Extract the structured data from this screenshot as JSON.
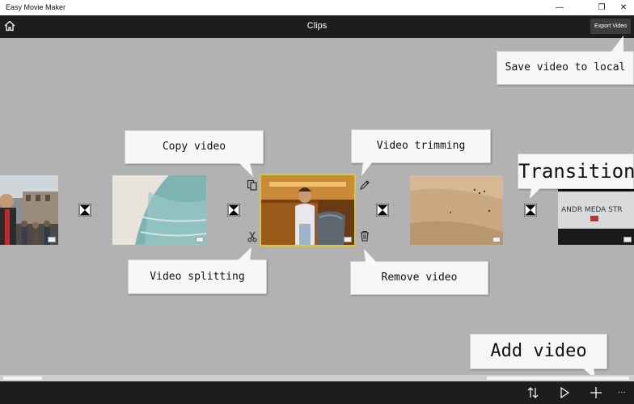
{
  "window": {
    "title": "Easy Movie Maker",
    "minimize_glyph": "—",
    "restore_glyph": "❐",
    "close_glyph": "✕"
  },
  "appbar": {
    "title": "Clips",
    "export_label": "Export Video",
    "home_icon": "home-icon"
  },
  "callouts": {
    "save_local": "Save video to local",
    "copy": "Copy video",
    "trimming": "Video trimming",
    "transition": "Transition",
    "splitting": "Video splitting",
    "remove": "Remove video",
    "add": "Add video"
  },
  "clips": [
    {
      "name": "clip-1-street-scene"
    },
    {
      "name": "clip-2-beach-water"
    },
    {
      "name": "clip-3-man-with-chair",
      "selected": true
    },
    {
      "name": "clip-4-sand-desert"
    },
    {
      "name": "clip-5-andromeda-sign"
    }
  ],
  "clip5_sign_text": "ANDR MEDA STR",
  "colors": {
    "workspace": "#b2b2b2",
    "bars": "#1d1d1d",
    "selection": "#d6c63a"
  },
  "toolbar_icons": [
    "sort-icon",
    "play-icon",
    "add-icon",
    "more-icon"
  ],
  "more_glyph": "···"
}
